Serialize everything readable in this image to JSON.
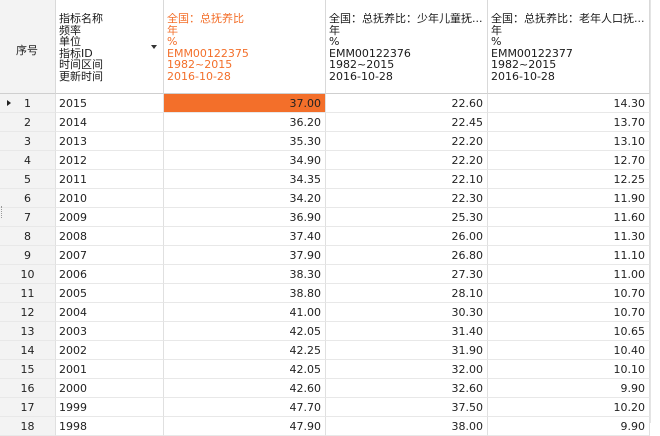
{
  "header": {
    "seq_label": "序号",
    "meta_lines": [
      "指标名称",
      "频率",
      "单位",
      "指标ID",
      "时间区间",
      "更新时间"
    ],
    "columns": [
      {
        "lines": [
          "全国：总抚养比",
          "年",
          "%",
          "EMM00122375",
          "1982~2015",
          "2016-10-28"
        ]
      },
      {
        "lines": [
          "全国：总抚养比：少年儿童抚...",
          "年",
          "%",
          "EMM00122376",
          "1982~2015",
          "2016-10-28"
        ]
      },
      {
        "lines": [
          "全国：总抚养比：老年人口抚...",
          "年",
          "%",
          "EMM00122377",
          "1982~2015",
          "2016-10-28"
        ]
      }
    ]
  },
  "colors": {
    "accent": "#f36f2a"
  },
  "rows": [
    {
      "seq": "1",
      "year": "2015",
      "v1": "37.00",
      "v2": "22.60",
      "v3": "14.30"
    },
    {
      "seq": "2",
      "year": "2014",
      "v1": "36.20",
      "v2": "22.45",
      "v3": "13.70"
    },
    {
      "seq": "3",
      "year": "2013",
      "v1": "35.30",
      "v2": "22.20",
      "v3": "13.10"
    },
    {
      "seq": "4",
      "year": "2012",
      "v1": "34.90",
      "v2": "22.20",
      "v3": "12.70"
    },
    {
      "seq": "5",
      "year": "2011",
      "v1": "34.35",
      "v2": "22.10",
      "v3": "12.25"
    },
    {
      "seq": "6",
      "year": "2010",
      "v1": "34.20",
      "v2": "22.30",
      "v3": "11.90"
    },
    {
      "seq": "7",
      "year": "2009",
      "v1": "36.90",
      "v2": "25.30",
      "v3": "11.60"
    },
    {
      "seq": "8",
      "year": "2008",
      "v1": "37.40",
      "v2": "26.00",
      "v3": "11.30"
    },
    {
      "seq": "9",
      "year": "2007",
      "v1": "37.90",
      "v2": "26.80",
      "v3": "11.10"
    },
    {
      "seq": "10",
      "year": "2006",
      "v1": "38.30",
      "v2": "27.30",
      "v3": "11.00"
    },
    {
      "seq": "11",
      "year": "2005",
      "v1": "38.80",
      "v2": "28.10",
      "v3": "10.70"
    },
    {
      "seq": "12",
      "year": "2004",
      "v1": "41.00",
      "v2": "30.30",
      "v3": "10.70"
    },
    {
      "seq": "13",
      "year": "2003",
      "v1": "42.05",
      "v2": "31.40",
      "v3": "10.65"
    },
    {
      "seq": "14",
      "year": "2002",
      "v1": "42.25",
      "v2": "31.90",
      "v3": "10.40"
    },
    {
      "seq": "15",
      "year": "2001",
      "v1": "42.05",
      "v2": "32.00",
      "v3": "10.10"
    },
    {
      "seq": "16",
      "year": "2000",
      "v1": "42.60",
      "v2": "32.60",
      "v3": "9.90"
    },
    {
      "seq": "17",
      "year": "1999",
      "v1": "47.70",
      "v2": "37.50",
      "v3": "10.20"
    },
    {
      "seq": "18",
      "year": "1998",
      "v1": "47.90",
      "v2": "38.00",
      "v3": "9.90"
    }
  ]
}
